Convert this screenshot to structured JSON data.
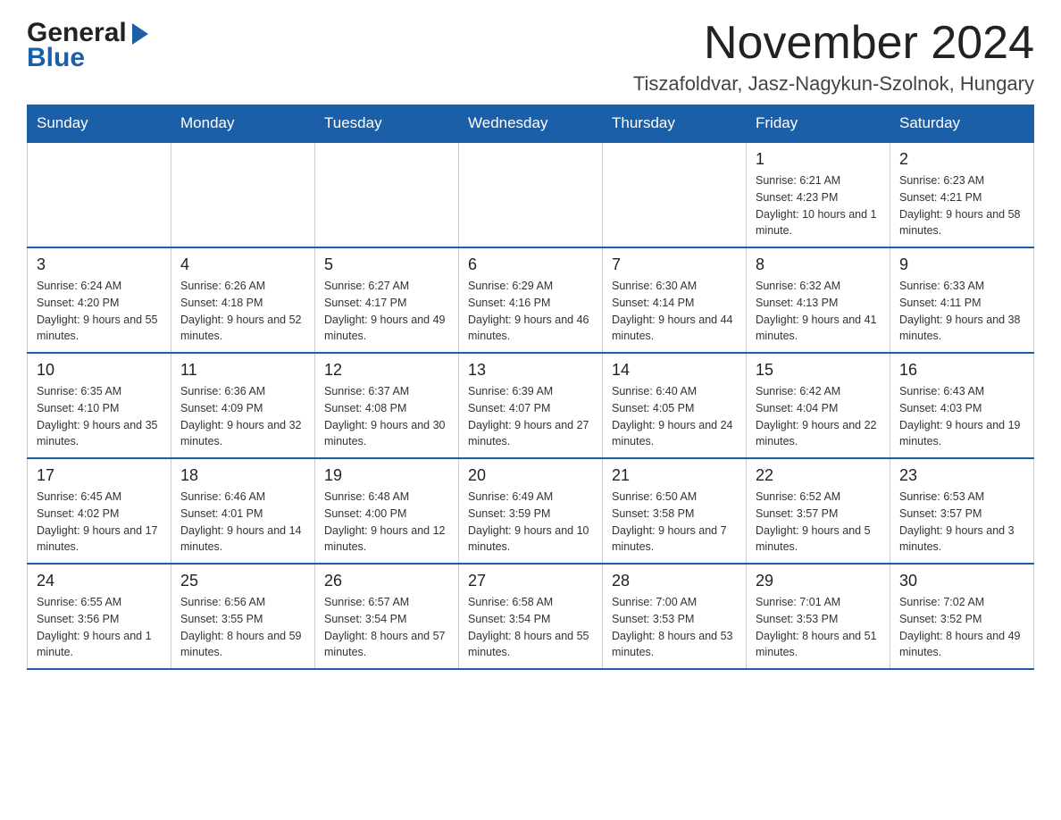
{
  "header": {
    "logo_general": "General",
    "logo_blue": "Blue",
    "month_title": "November 2024",
    "location": "Tiszafoldvar, Jasz-Nagykun-Szolnok, Hungary"
  },
  "weekdays": [
    "Sunday",
    "Monday",
    "Tuesday",
    "Wednesday",
    "Thursday",
    "Friday",
    "Saturday"
  ],
  "weeks": [
    [
      {
        "day": "",
        "info": ""
      },
      {
        "day": "",
        "info": ""
      },
      {
        "day": "",
        "info": ""
      },
      {
        "day": "",
        "info": ""
      },
      {
        "day": "",
        "info": ""
      },
      {
        "day": "1",
        "info": "Sunrise: 6:21 AM\nSunset: 4:23 PM\nDaylight: 10 hours and 1 minute."
      },
      {
        "day": "2",
        "info": "Sunrise: 6:23 AM\nSunset: 4:21 PM\nDaylight: 9 hours and 58 minutes."
      }
    ],
    [
      {
        "day": "3",
        "info": "Sunrise: 6:24 AM\nSunset: 4:20 PM\nDaylight: 9 hours and 55 minutes."
      },
      {
        "day": "4",
        "info": "Sunrise: 6:26 AM\nSunset: 4:18 PM\nDaylight: 9 hours and 52 minutes."
      },
      {
        "day": "5",
        "info": "Sunrise: 6:27 AM\nSunset: 4:17 PM\nDaylight: 9 hours and 49 minutes."
      },
      {
        "day": "6",
        "info": "Sunrise: 6:29 AM\nSunset: 4:16 PM\nDaylight: 9 hours and 46 minutes."
      },
      {
        "day": "7",
        "info": "Sunrise: 6:30 AM\nSunset: 4:14 PM\nDaylight: 9 hours and 44 minutes."
      },
      {
        "day": "8",
        "info": "Sunrise: 6:32 AM\nSunset: 4:13 PM\nDaylight: 9 hours and 41 minutes."
      },
      {
        "day": "9",
        "info": "Sunrise: 6:33 AM\nSunset: 4:11 PM\nDaylight: 9 hours and 38 minutes."
      }
    ],
    [
      {
        "day": "10",
        "info": "Sunrise: 6:35 AM\nSunset: 4:10 PM\nDaylight: 9 hours and 35 minutes."
      },
      {
        "day": "11",
        "info": "Sunrise: 6:36 AM\nSunset: 4:09 PM\nDaylight: 9 hours and 32 minutes."
      },
      {
        "day": "12",
        "info": "Sunrise: 6:37 AM\nSunset: 4:08 PM\nDaylight: 9 hours and 30 minutes."
      },
      {
        "day": "13",
        "info": "Sunrise: 6:39 AM\nSunset: 4:07 PM\nDaylight: 9 hours and 27 minutes."
      },
      {
        "day": "14",
        "info": "Sunrise: 6:40 AM\nSunset: 4:05 PM\nDaylight: 9 hours and 24 minutes."
      },
      {
        "day": "15",
        "info": "Sunrise: 6:42 AM\nSunset: 4:04 PM\nDaylight: 9 hours and 22 minutes."
      },
      {
        "day": "16",
        "info": "Sunrise: 6:43 AM\nSunset: 4:03 PM\nDaylight: 9 hours and 19 minutes."
      }
    ],
    [
      {
        "day": "17",
        "info": "Sunrise: 6:45 AM\nSunset: 4:02 PM\nDaylight: 9 hours and 17 minutes."
      },
      {
        "day": "18",
        "info": "Sunrise: 6:46 AM\nSunset: 4:01 PM\nDaylight: 9 hours and 14 minutes."
      },
      {
        "day": "19",
        "info": "Sunrise: 6:48 AM\nSunset: 4:00 PM\nDaylight: 9 hours and 12 minutes."
      },
      {
        "day": "20",
        "info": "Sunrise: 6:49 AM\nSunset: 3:59 PM\nDaylight: 9 hours and 10 minutes."
      },
      {
        "day": "21",
        "info": "Sunrise: 6:50 AM\nSunset: 3:58 PM\nDaylight: 9 hours and 7 minutes."
      },
      {
        "day": "22",
        "info": "Sunrise: 6:52 AM\nSunset: 3:57 PM\nDaylight: 9 hours and 5 minutes."
      },
      {
        "day": "23",
        "info": "Sunrise: 6:53 AM\nSunset: 3:57 PM\nDaylight: 9 hours and 3 minutes."
      }
    ],
    [
      {
        "day": "24",
        "info": "Sunrise: 6:55 AM\nSunset: 3:56 PM\nDaylight: 9 hours and 1 minute."
      },
      {
        "day": "25",
        "info": "Sunrise: 6:56 AM\nSunset: 3:55 PM\nDaylight: 8 hours and 59 minutes."
      },
      {
        "day": "26",
        "info": "Sunrise: 6:57 AM\nSunset: 3:54 PM\nDaylight: 8 hours and 57 minutes."
      },
      {
        "day": "27",
        "info": "Sunrise: 6:58 AM\nSunset: 3:54 PM\nDaylight: 8 hours and 55 minutes."
      },
      {
        "day": "28",
        "info": "Sunrise: 7:00 AM\nSunset: 3:53 PM\nDaylight: 8 hours and 53 minutes."
      },
      {
        "day": "29",
        "info": "Sunrise: 7:01 AM\nSunset: 3:53 PM\nDaylight: 8 hours and 51 minutes."
      },
      {
        "day": "30",
        "info": "Sunrise: 7:02 AM\nSunset: 3:52 PM\nDaylight: 8 hours and 49 minutes."
      }
    ]
  ]
}
